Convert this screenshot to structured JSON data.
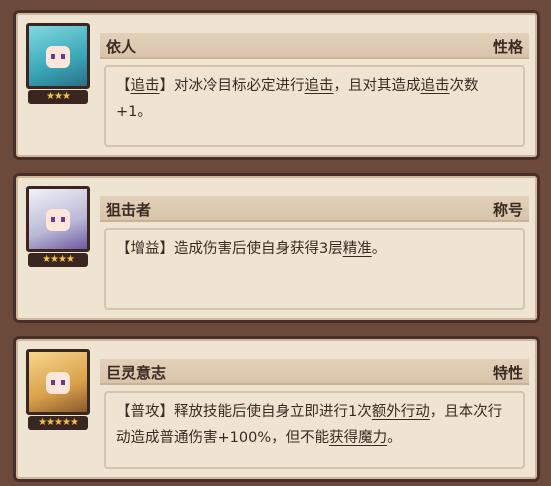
{
  "cards": [
    {
      "name": "依人",
      "tag": "性格",
      "stars": "★★★",
      "desc": {
        "p0": "【",
        "k0": "追击",
        "p1": "】对冰冷目标必定进行",
        "k1": "追击",
        "p2": "，且对其造成",
        "k2": "追击",
        "p3": "次数+1。"
      }
    },
    {
      "name": "狙击者",
      "tag": "称号",
      "stars": "★★★★",
      "desc": {
        "p0": "【增益】造成伤害后使自身获得3层",
        "k0": "精准",
        "p1": "。"
      }
    },
    {
      "name": "巨灵意志",
      "tag": "特性",
      "stars": "★★★★★",
      "desc": {
        "p0": "【普攻】释放技能后使自身立即进行1次",
        "k0": "额外行动",
        "p1": "，且本次行动造成普通伤害+100%，但不能",
        "k1": "获得魔力",
        "p2": "。"
      }
    }
  ]
}
